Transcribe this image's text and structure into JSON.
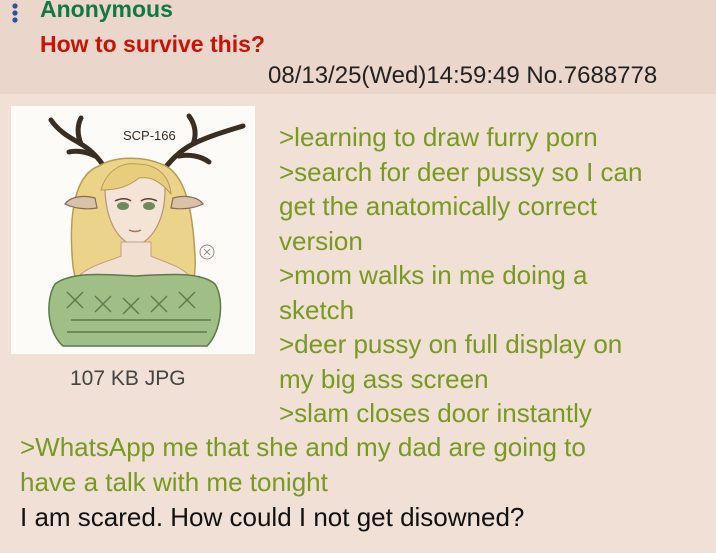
{
  "post": {
    "name": "Anonymous",
    "subject": "How to survive this?",
    "datetime": "08/13/25(Wed)14:59:49",
    "number": "No.7688778",
    "file": {
      "info": "107 KB JPG",
      "image_caption": "SCP-166"
    },
    "body_right_lines": [
      ">learning to draw furry porn",
      ">search for deer pussy so I can",
      "get the anatomically correct",
      "version",
      ">mom walks in me doing a",
      "sketch",
      ">deer pussy on full display on",
      "my big ass screen",
      ">slam closes door instantly"
    ],
    "body_full_lines": [
      ">WhatsApp me that she and my dad are going to",
      "have a talk with me tonight"
    ],
    "plain_line": "I am scared. How could I not get disowned?"
  },
  "colors": {
    "background": "#f0e0d6",
    "name": "#117743",
    "subject": "#cc1105",
    "greentext": "#789922",
    "menu": "#2255aa"
  },
  "icons": {
    "menu": "vertical-dots-icon"
  }
}
